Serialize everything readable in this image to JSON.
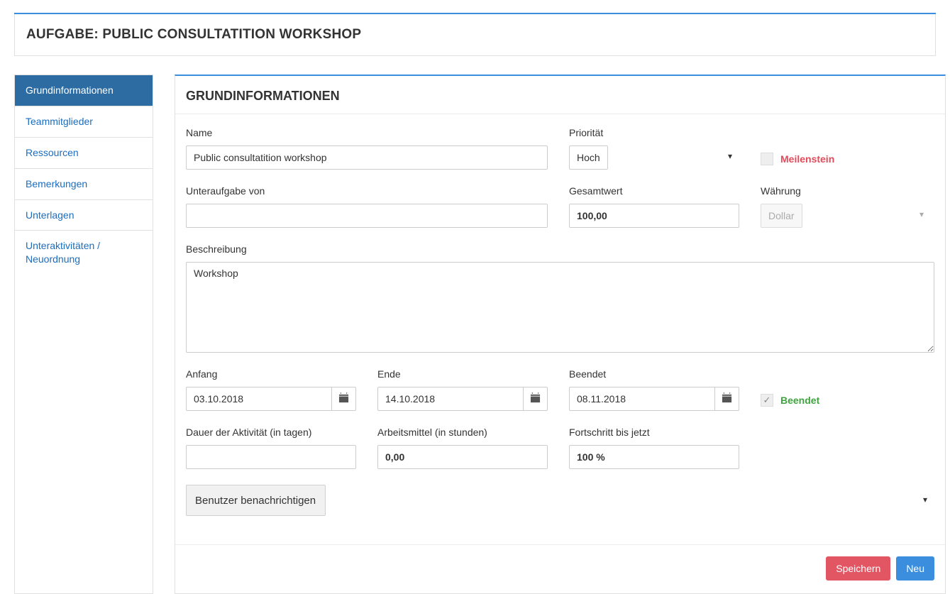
{
  "page_title": "AUFGABE: PUBLIC CONSULTATITION WORKSHOP",
  "sidebar": {
    "items": [
      {
        "label": "Grundinformationen",
        "active": true
      },
      {
        "label": "Teammitglieder",
        "active": false
      },
      {
        "label": "Ressourcen",
        "active": false
      },
      {
        "label": "Bemerkungen",
        "active": false
      },
      {
        "label": "Unterlagen",
        "active": false
      },
      {
        "label": "Unteraktivitäten / Neuordnung",
        "active": false
      }
    ]
  },
  "section_title": "GRUNDINFORMATIONEN",
  "fields": {
    "name": {
      "label": "Name",
      "value": "Public consultatition workshop"
    },
    "priority": {
      "label": "Priorität",
      "value": "Hoch"
    },
    "milestone": {
      "label": "Meilenstein",
      "checked": false
    },
    "subtask_of": {
      "label": "Unteraufgabe von",
      "value": ""
    },
    "total_value": {
      "label": "Gesamtwert",
      "value": "100,00"
    },
    "currency": {
      "label": "Währung",
      "value": "Dollar"
    },
    "description": {
      "label": "Beschreibung",
      "value": "Workshop"
    },
    "start": {
      "label": "Anfang",
      "value": "03.10.2018"
    },
    "end": {
      "label": "Ende",
      "value": "14.10.2018"
    },
    "finished_date": {
      "label": "Beendet",
      "value": "08.11.2018"
    },
    "finished": {
      "label": "Beendet",
      "checked": true
    },
    "duration": {
      "label": "Dauer der Aktivität (in tagen)",
      "value": ""
    },
    "work_hours": {
      "label": "Arbeitsmittel (in stunden)",
      "value": "0,00"
    },
    "progress": {
      "label": "Fortschritt bis jetzt",
      "value": "100 %"
    },
    "notify": {
      "label": "Benutzer benachrichtigen"
    }
  },
  "buttons": {
    "save": "Speichern",
    "new": "Neu"
  }
}
